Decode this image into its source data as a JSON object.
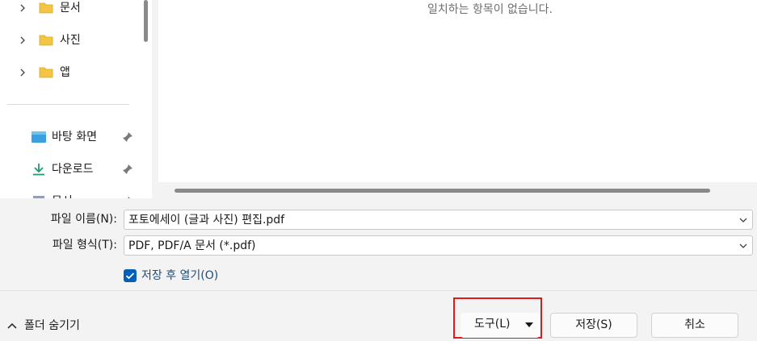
{
  "nav": {
    "tree_items": [
      {
        "label": "문서"
      },
      {
        "label": "사진"
      },
      {
        "label": "앱"
      }
    ],
    "quick_access": [
      {
        "label": "바탕 화면",
        "icon": "desktop-icon"
      },
      {
        "label": "다운로드",
        "icon": "download-icon"
      },
      {
        "label": "문서",
        "icon": "document-icon"
      }
    ]
  },
  "content": {
    "empty_message": "일치하는 항목이 없습니다."
  },
  "form": {
    "filename_label": "파일 이름(N):",
    "filename_value": "포토에세이 (글과 사진) 편집.pdf",
    "filetype_label": "파일 형식(T):",
    "filetype_value": "PDF, PDF/A 문서 (*.pdf)",
    "open_after_save_label": "저장 후 열기(O)",
    "open_after_save_checked": true
  },
  "footer": {
    "hide_folders_label": "폴더 숨기기",
    "tools_label": "도구(L)",
    "save_label": "저장(S)",
    "cancel_label": "취소"
  },
  "colors": {
    "accent": "#005fb8",
    "highlight": "#e01b1b",
    "folder": "#f4c542"
  }
}
